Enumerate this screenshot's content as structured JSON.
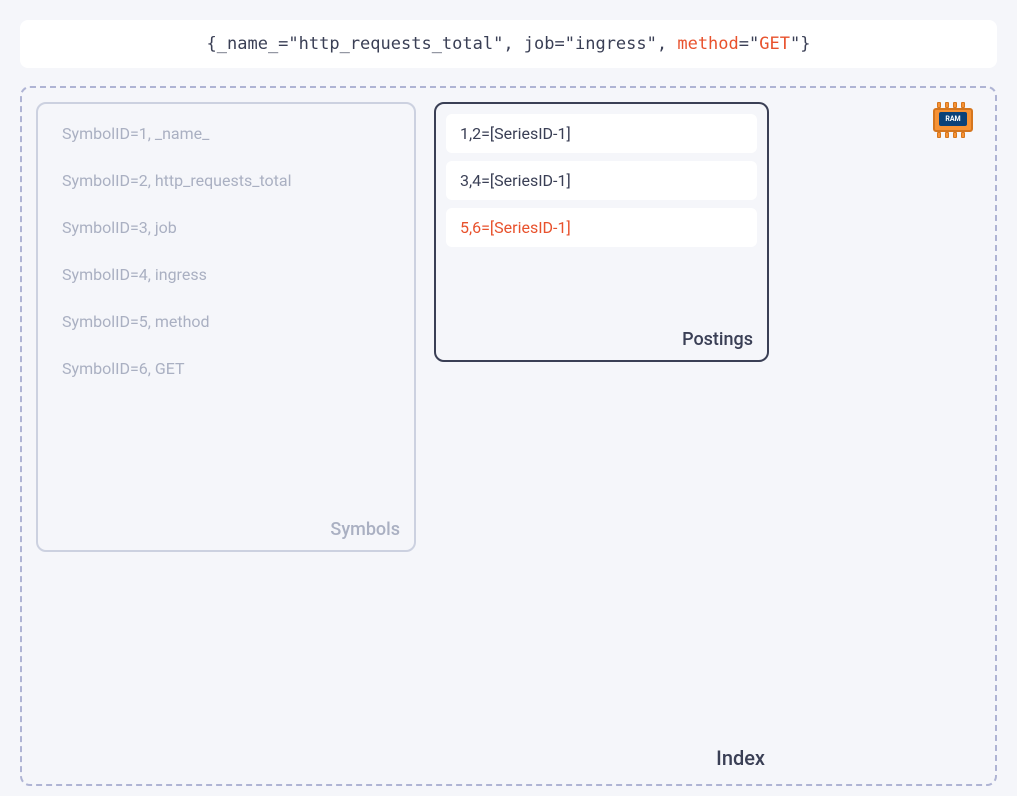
{
  "query": {
    "parts": [
      {
        "text": "{_name_=\"http_requests_total\", job=\"ingress\", ",
        "hl": false
      },
      {
        "text": "method",
        "hl": true
      },
      {
        "text": "=\"",
        "hl": false
      },
      {
        "text": "GET",
        "hl": true
      },
      {
        "text": "\"}",
        "hl": false
      }
    ]
  },
  "ram": {
    "label": "RAM"
  },
  "index": {
    "label": "Index",
    "symbols": {
      "label": "Symbols",
      "items": [
        "SymbolID=1, _name_",
        "SymbolID=2, http_requests_total",
        "SymbolID=3, job",
        "SymbolID=4, ingress",
        "SymbolID=5, method",
        "SymbolID=6, GET"
      ]
    },
    "postings": {
      "label": "Postings",
      "items": [
        {
          "text": "1,2=[SeriesID-1]",
          "highlight": false
        },
        {
          "text": "3,4=[SeriesID-1]",
          "highlight": false
        },
        {
          "text": "5,6=[SeriesID-1]",
          "highlight": true
        }
      ]
    }
  }
}
